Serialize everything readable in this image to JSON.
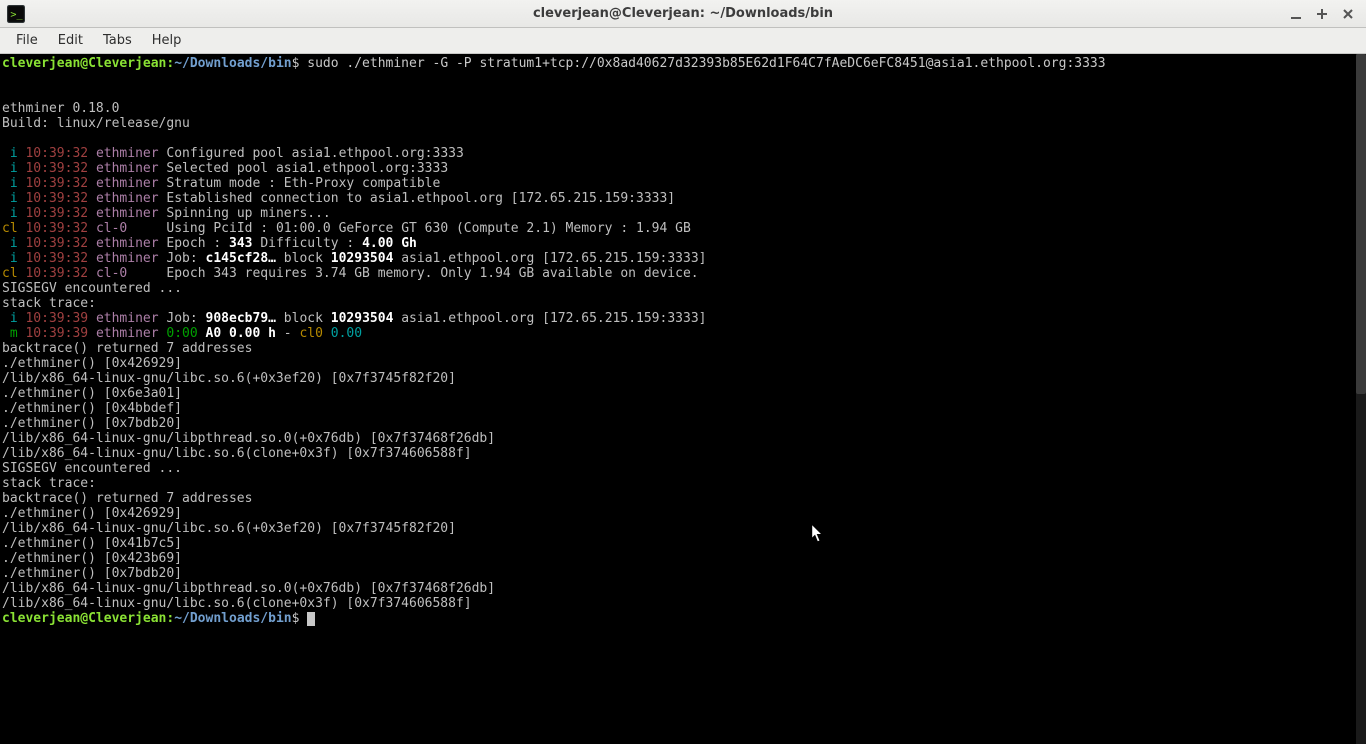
{
  "window": {
    "title": "cleverjean@Cleverjean: ~/Downloads/bin"
  },
  "menu": {
    "file": "File",
    "edit": "Edit",
    "tabs": "Tabs",
    "help": "Help"
  },
  "prompt": {
    "user_host": "cleverjean@Cleverjean",
    "colon": ":",
    "path": "~/Downloads/bin",
    "dollar": "$"
  },
  "command": " sudo ./ethminer -G -P stratum1+tcp://0x8ad40627d32393b85E62d1F64C7fAeDC6eFC8451@asia1.ethpool.org:3333",
  "banner": {
    "l1": "ethminer 0.18.0",
    "l2": "Build: linux/release/gnu"
  },
  "log": [
    {
      "tag": " i",
      "time": "10:39:32",
      "src": "ethminer",
      "msg": "Configured pool asia1.ethpool.org:3333"
    },
    {
      "tag": " i",
      "time": "10:39:32",
      "src": "ethminer",
      "msg": "Selected pool asia1.ethpool.org:3333"
    },
    {
      "tag": " i",
      "time": "10:39:32",
      "src": "ethminer",
      "msg": "Stratum mode : Eth-Proxy compatible"
    },
    {
      "tag": " i",
      "time": "10:39:32",
      "src": "ethminer",
      "msg": "Established connection to asia1.ethpool.org [172.65.215.159:3333]"
    },
    {
      "tag": " i",
      "time": "10:39:32",
      "src": "ethminer",
      "msg": "Spinning up miners..."
    },
    {
      "tag": "cl",
      "time": "10:39:32",
      "src": "cl-0    ",
      "msg": "Using PciId : 01:00.0 GeForce GT 630 (Compute 2.1) Memory : 1.94 GB"
    },
    {
      "tag": " i",
      "time": "10:39:32",
      "src": "ethminer",
      "msg_pre": "Epoch : ",
      "msg_bold": "343",
      "msg_mid": " Difficulty : ",
      "msg_bold2": "4.00 Gh"
    },
    {
      "tag": " i",
      "time": "10:39:32",
      "src": "ethminer",
      "msg_pre": "Job: ",
      "msg_bold": "c145cf28…",
      "msg_mid": " block ",
      "msg_bold2": "10293504",
      "msg_post": " asia1.ethpool.org [172.65.215.159:3333]"
    },
    {
      "tag": "cl",
      "time": "10:39:32",
      "src": "cl-0    ",
      "msg": "Epoch 343 requires 3.74 GB memory. Only 1.94 GB available on device."
    }
  ],
  "plain1": [
    "SIGSEGV encountered ...",
    "stack trace:"
  ],
  "log2": [
    {
      "tag": " i",
      "time": "10:39:39",
      "src": "ethminer",
      "msg_pre": "Job: ",
      "msg_bold": "908ecb79…",
      "msg_mid": " block ",
      "msg_bold2": "10293504",
      "msg_post": " asia1.ethpool.org [172.65.215.159:3333]"
    }
  ],
  "metric": {
    "tag": " m",
    "time": "10:39:39",
    "src": "ethminer",
    "v1": "0:00",
    "v2": "A0",
    "v3": "0.00 h",
    "dash": " - ",
    "v4": "cl0",
    "v5": "0.00"
  },
  "trace1": [
    "backtrace() returned 7 addresses",
    "./ethminer() [0x426929]",
    "/lib/x86_64-linux-gnu/libc.so.6(+0x3ef20) [0x7f3745f82f20]",
    "./ethminer() [0x6e3a01]",
    "./ethminer() [0x4bbdef]",
    "./ethminer() [0x7bdb20]",
    "/lib/x86_64-linux-gnu/libpthread.so.0(+0x76db) [0x7f37468f26db]",
    "/lib/x86_64-linux-gnu/libc.so.6(clone+0x3f) [0x7f374606588f]",
    "SIGSEGV encountered ...",
    "stack trace:",
    "backtrace() returned 7 addresses",
    "./ethminer() [0x426929]",
    "/lib/x86_64-linux-gnu/libc.so.6(+0x3ef20) [0x7f3745f82f20]",
    "./ethminer() [0x41b7c5]",
    "./ethminer() [0x423b69]",
    "./ethminer() [0x7bdb20]",
    "/lib/x86_64-linux-gnu/libpthread.so.0(+0x76db) [0x7f37468f26db]",
    "/lib/x86_64-linux-gnu/libc.so.6(clone+0x3f) [0x7f374606588f]"
  ]
}
